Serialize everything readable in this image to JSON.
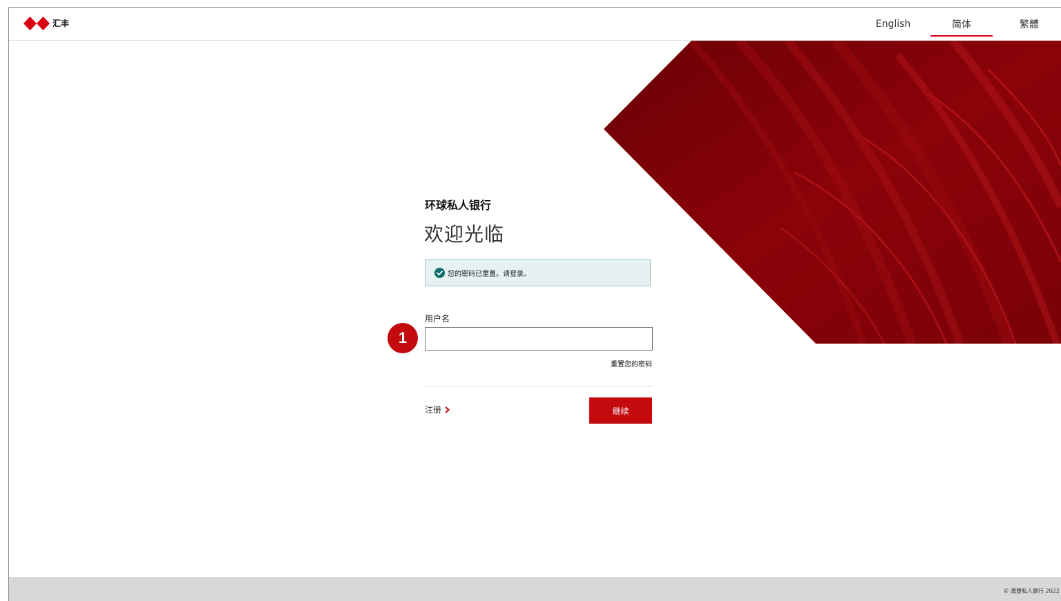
{
  "header": {
    "logo_text": "汇丰",
    "languages": [
      {
        "label": "English",
        "active": false
      },
      {
        "label": "简体",
        "active": true
      },
      {
        "label": "繁體",
        "active": false
      }
    ]
  },
  "login": {
    "brand_name": "环球私人银行",
    "welcome": "欢迎光临",
    "notice": "您的密码已重置。请登录。",
    "username_label": "用户名",
    "username_value": "",
    "reset_password": "重置您的密码",
    "register": "注册",
    "continue": "继续",
    "step_badge": "1"
  },
  "footer": {
    "copyright": "© 滙豐私人銀行 2022"
  },
  "colors": {
    "brand_red": "#db0011",
    "button_red": "#c20a0f",
    "notice_bg": "#e6f1f1",
    "notice_border": "#9fc7c6",
    "success_teal": "#0f6e6c"
  }
}
